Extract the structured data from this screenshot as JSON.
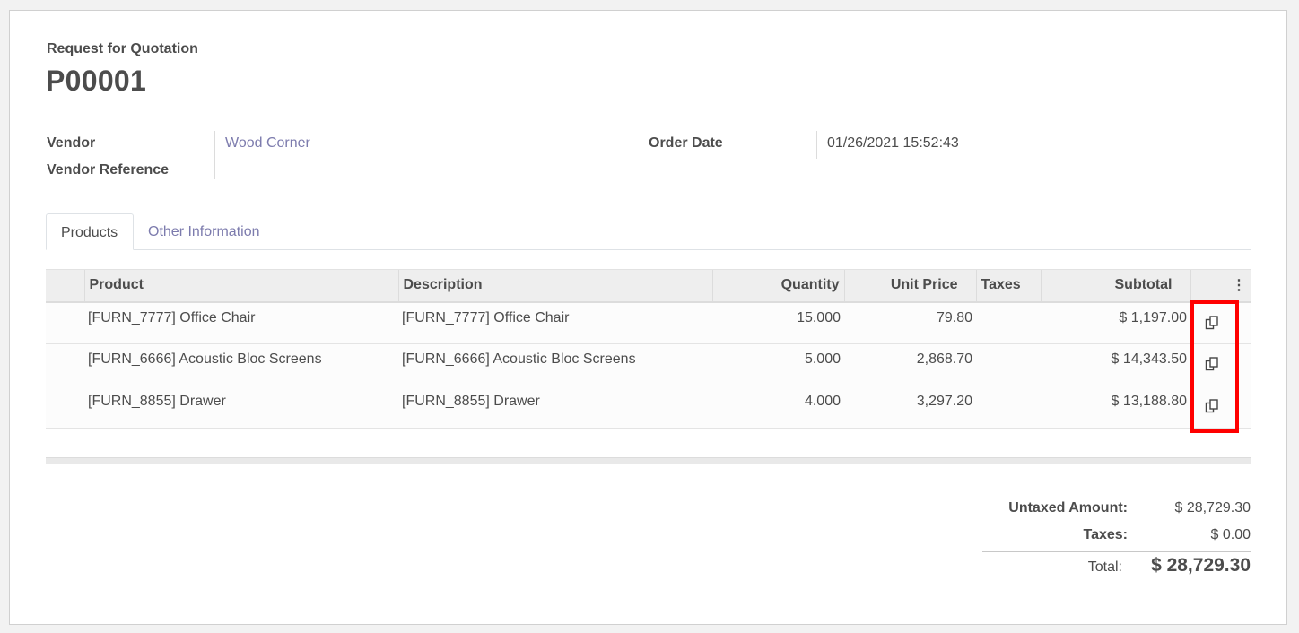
{
  "record": {
    "doc_type": "Request for Quotation",
    "name": "P00001"
  },
  "fields": {
    "vendor_label": "Vendor",
    "vendor_value": "Wood Corner",
    "vendor_ref_label": "Vendor Reference",
    "vendor_ref_value": "",
    "order_date_label": "Order Date",
    "order_date_value": "01/26/2021 15:52:43"
  },
  "tabs": [
    {
      "label": "Products",
      "active": true
    },
    {
      "label": "Other Information",
      "active": false
    }
  ],
  "table": {
    "headers": {
      "product": "Product",
      "description": "Description",
      "quantity": "Quantity",
      "unit_price": "Unit Price",
      "taxes": "Taxes",
      "subtotal": "Subtotal",
      "options": "⋮"
    },
    "rows": [
      {
        "product": "[FURN_7777] Office Chair",
        "description": "[FURN_7777] Office Chair",
        "quantity": "15.000",
        "unit_price": "79.80",
        "taxes": "",
        "subtotal": "$ 1,197.00",
        "action_icon": "copy-icon"
      },
      {
        "product": "[FURN_6666] Acoustic Bloc Screens",
        "description": "[FURN_6666] Acoustic Bloc Screens",
        "quantity": "5.000",
        "unit_price": "2,868.70",
        "taxes": "",
        "subtotal": "$ 14,343.50",
        "action_icon": "copy-icon"
      },
      {
        "product": "[FURN_8855] Drawer",
        "description": "[FURN_8855] Drawer",
        "quantity": "4.000",
        "unit_price": "3,297.20",
        "taxes": "",
        "subtotal": "$ 13,188.80",
        "action_icon": "copy-icon"
      }
    ]
  },
  "totals": {
    "untaxed_label": "Untaxed Amount:",
    "untaxed_value": "$ 28,729.30",
    "taxes_label": "Taxes:",
    "taxes_value": "$ 0.00",
    "total_label": "Total:",
    "total_value": "$ 28,729.30"
  },
  "colors": {
    "link": "#7c7bad",
    "text": "#4c4c4c",
    "highlight": "#ff0000"
  }
}
